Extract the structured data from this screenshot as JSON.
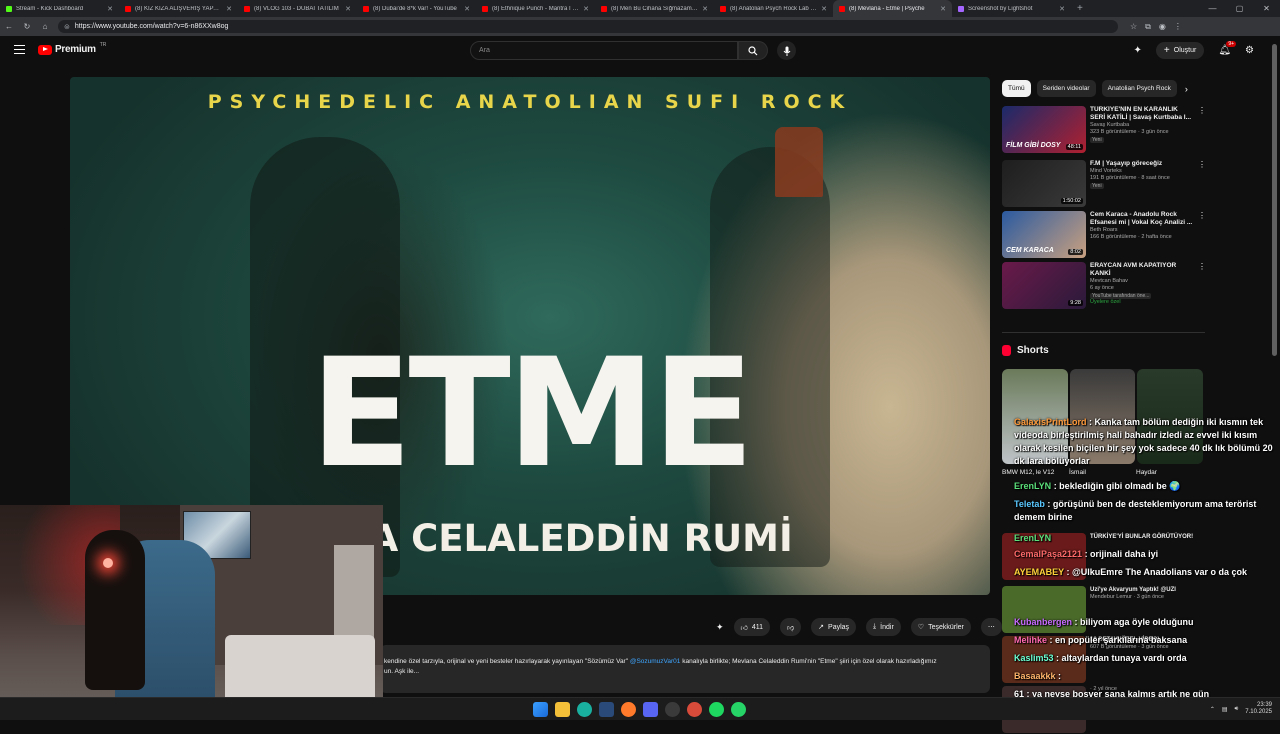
{
  "browser": {
    "tabs": [
      {
        "title": "Stream - Kick Dashboard",
        "color": "#53fc18",
        "active": false
      },
      {
        "title": "(8) KIZ KIZA ALIŞVERİŞ YAPALIM",
        "color": "#ff0000",
        "active": false
      },
      {
        "title": "(8) VLOG 103 - DUBAİ TATİLİM",
        "color": "#ff0000",
        "active": false
      },
      {
        "title": "(8) Dubai'de 8*k Var! - YouTube",
        "color": "#ff0000",
        "active": false
      },
      {
        "title": "(8) Ethnique Punch - Mantra I Bal",
        "color": "#ff0000",
        "active": false
      },
      {
        "title": "(8) Men Bu Cihana Sığmazam | Pi",
        "color": "#ff0000",
        "active": false
      },
      {
        "title": "(8) Anatolian Psych Rock Lab - Yo",
        "color": "#ff0000",
        "active": false
      },
      {
        "title": "(8) Mevlana - Etme | Psyche",
        "color": "#ff0000",
        "active": true
      },
      {
        "title": "Screenshot by Lightshot",
        "color": "#a566ff",
        "active": false
      }
    ],
    "url": "https://www.youtube.com/watch?v=6-n86XXw8og"
  },
  "header": {
    "logo_text": "Premium",
    "logo_region": "TR",
    "search_placeholder": "Ara",
    "create_label": "Oluştur",
    "notif_count": "9+"
  },
  "video": {
    "top_heading": "PSYCHEDELIC ANATOLIAN SUFI ROCK",
    "big_title": "ETME",
    "subtitle": "ANA CELALEDDİN RUMİ"
  },
  "actions": {
    "like_count": "411",
    "share_label": "Paylaş",
    "download_label": "İndir",
    "thanks_label": "Teşekkürler"
  },
  "description": {
    "line1_a": "kendine özel tarzıyla, orijinal ve yeni besteler hazırlayarak yayınlayan \"Sözümüz Var\"",
    "line1_link": "@SozumuzVar01",
    "line1_b": "kanalıyla birlikte; Mevlana Celaleddin Rumi'nin \"Etme\" şiiri için özel olarak hazırladığımız",
    "line2": "un. Aşk ile..."
  },
  "sidebar": {
    "chips": [
      "Tümü",
      "Seriden videolar",
      "Anatolian Psych Rock"
    ],
    "recs": [
      {
        "title": "TÜRKİYE'NİN EN KARANLIK SERİ KATİLİ | Savaş Kurtbaba I...",
        "channel": "Savaş Kurtbaba",
        "views": "323 B görüntüleme · 3 gün önce",
        "badge": "Yeni",
        "duration": "48:11",
        "thumbtext": "FİLM GİBİ DOSY",
        "color1": "#1a2a6a",
        "color2": "#b02030"
      },
      {
        "title": "F.M | Yaşayıp göreceğiz",
        "channel": "Mind Vorteks",
        "views": "191 B görüntüleme · 8 saat önce",
        "badge": "Yeni",
        "duration": "1:50:02",
        "thumbtext": "",
        "color1": "#1e1e1e",
        "color2": "#3a3a3a"
      },
      {
        "title": "Cem Karaca - Anadolu Rock Efsanesi mi | Vokal Koç Analizi ...",
        "channel": "Beth Roars",
        "views": "166 B görüntüleme · 2 hafta önce",
        "badge": "",
        "duration": "8:02",
        "thumbtext": "CEM KARACA",
        "color1": "#2a5aa0",
        "color2": "#c9a080"
      },
      {
        "title": "ERAYCAN AVM KAPATIYOR KANKİ",
        "channel": "Mevtcan Bahav",
        "views": "6 ay önce",
        "badge": "YouTube tarafından öne...",
        "extra": "Üyelere özel",
        "duration": "9:28",
        "thumbtext": "",
        "color1": "#6a1a4a",
        "color2": "#2a1a3a"
      }
    ],
    "shorts_heading": "Shorts",
    "shorts_captions": [
      "BMW M12, le V12",
      "İsmail",
      "Haydar"
    ],
    "shorts_views": [
      "",
      "",
      "8,8 B"
    ]
  },
  "lower_recs": [
    {
      "title": "TÜRKİYE'Yİ BUNLAR GÖRÜTÜYOR!",
      "meta": "",
      "color": "#6a1a1a"
    },
    {
      "title": "Uzi'ye Akvaryum Yaptık! @UZI",
      "meta": "Mendebur Lemur · 3 gün önce",
      "color": "#4a6a2a"
    },
    {
      "title": "10 DETAY (ÖZEL VİDEO)",
      "meta": "607 B görüntüleme · 3 gün önce",
      "color": "#5a2a1a"
    },
    {
      "title": "",
      "meta": "· 2 yıl önce",
      "color": "#3a2a2a"
    }
  ],
  "chat": [
    {
      "user": "GalaxisPrintLord",
      "text": ": Kanka tam bölüm dediğin iki kısmın tek videoda birleştirilmiş hali bahadır izledi az evvel iki kısım olarak kesilen biçilen bir şey yok sadece 40 dk lık bölümü 20 dk lara bölüyorlar",
      "ucolor": "#ff9a3a"
    },
    {
      "user": "ErenLYN",
      "text": ": beklediğin gibi olmadı be 🌍",
      "ucolor": "#5adf7a"
    },
    {
      "user": "Teletab",
      "text": ": görüşünü ben de desteklemiyorum ama terörist demem birine",
      "ucolor": "#5ac8ff"
    },
    {
      "user": "ErenLYN",
      "text": "",
      "ucolor": "#5adf7a"
    },
    {
      "user": "CemalPaşa2121",
      "text": ": orijinali daha iyi",
      "ucolor": "#ff6a6a"
    },
    {
      "user": "AYEMABEY",
      "text": ": @UlkuEmre The Anadolians var o da çok",
      "ucolor": "#ffd23a"
    },
    {
      "user": "Kubanbergen",
      "text": ": biliyom aga öyle olduğunu",
      "ucolor": "#c86aff"
    },
    {
      "user": "Melihke",
      "text": ": en popüler şarkılarına baksana",
      "ucolor": "#ff6ab0"
    },
    {
      "user": "Kaslim53",
      "text": ": altaylardan tunaya vardı orda",
      "ucolor": "#6affd2"
    },
    {
      "user": "Basaakkk",
      "text": ":",
      "ucolor": "#ffb36a"
    },
    {
      "user": "61",
      "text": ": ya neyse boşver sana kalmış artık ne gün",
      "ucolor": "#ffffff"
    }
  ],
  "taskbar": {
    "time": "23:39",
    "date": "7.10.2025"
  }
}
